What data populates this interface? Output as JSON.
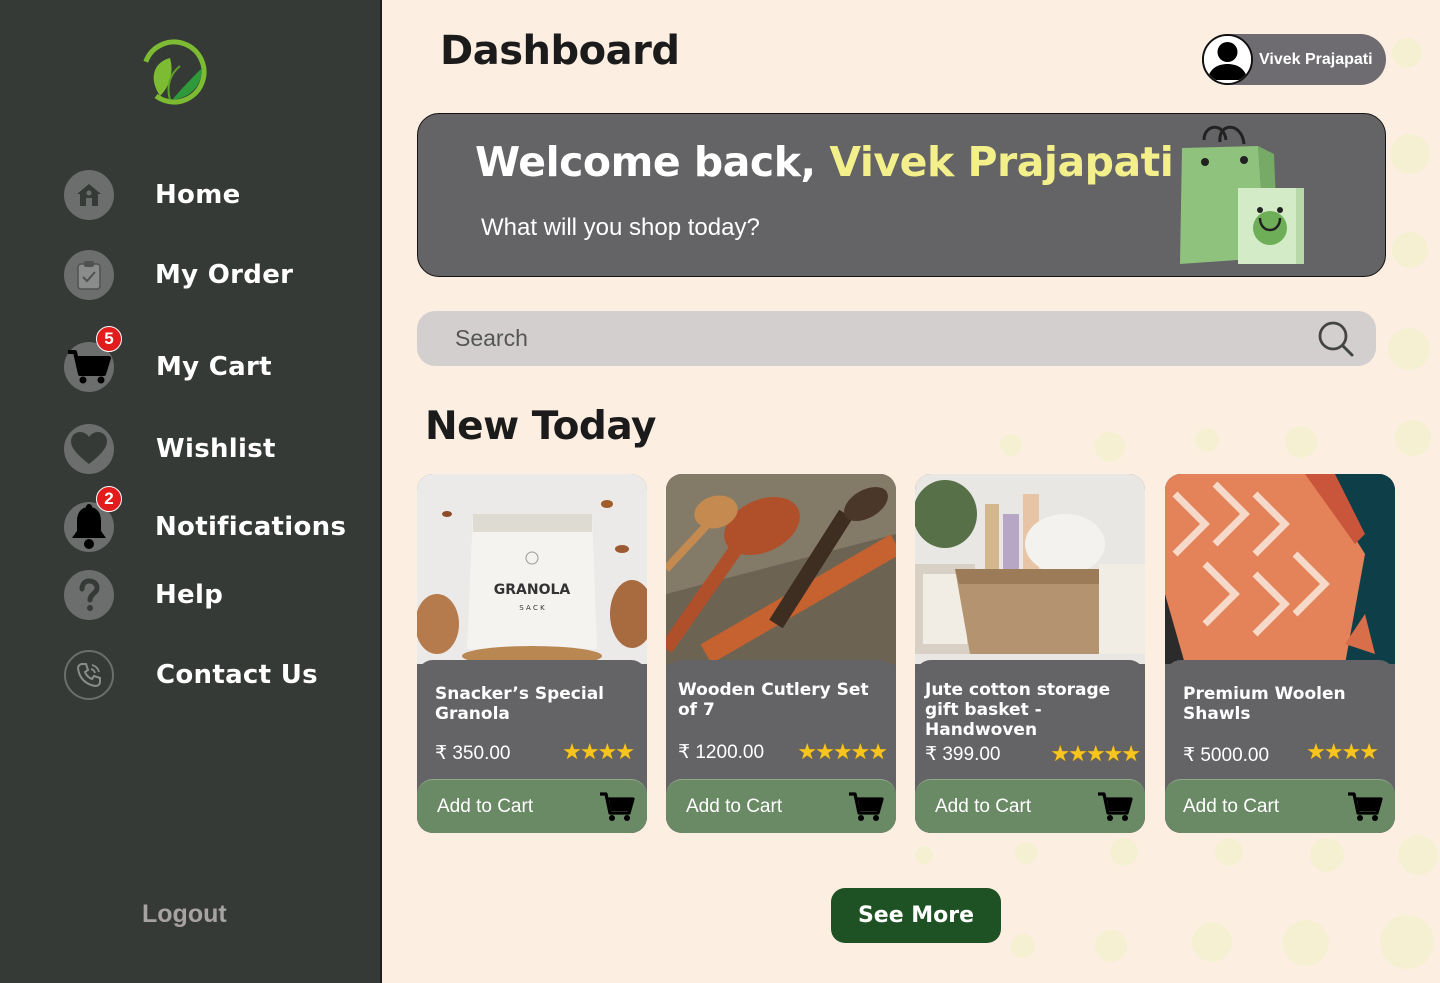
{
  "app": {
    "brand_colors": {
      "sidebar": "#363a37",
      "accent": "#1e5225",
      "card_button": "#6a8965",
      "highlight": "#f3f08b",
      "badge": "#e21c1c"
    }
  },
  "sidebar": {
    "logo_icon": "leaf-logo",
    "items": [
      {
        "label": "Home",
        "icon": "home-icon"
      },
      {
        "label": "My Order",
        "icon": "clipboard-check-icon"
      },
      {
        "label": "My Cart",
        "icon": "cart-icon",
        "badge": "5"
      },
      {
        "label": "Wishlist",
        "icon": "heart-icon"
      },
      {
        "label": "Notifications",
        "icon": "bell-icon",
        "badge": "2"
      },
      {
        "label": "Help",
        "icon": "question-icon"
      },
      {
        "label": "Contact Us",
        "icon": "phone-icon"
      }
    ],
    "logout_label": "Logout"
  },
  "header": {
    "title": "Dashboard",
    "user_name": "Vivek Prajapati"
  },
  "banner": {
    "welcome_prefix": "Welcome back, ",
    "welcome_name": "Vivek Prajapati",
    "subtitle": "What will you shop today?"
  },
  "search": {
    "placeholder": "Search"
  },
  "section": {
    "title": "New Today"
  },
  "products": [
    {
      "name": "Snacker’s Special Granola",
      "price": "₹ 350.00",
      "stars": "★★★★",
      "rating": 4,
      "button": "Add to Cart"
    },
    {
      "name": "Wooden Cutlery Set of 7",
      "price": "₹ 1200.00",
      "stars": "★★★★★",
      "rating": 5,
      "button": "Add to Cart"
    },
    {
      "name": "Jute cotton storage gift basket - Handwoven",
      "price": "₹ 399.00",
      "stars": "★★★★★",
      "rating": 5,
      "button": "Add to Cart"
    },
    {
      "name": "Premium Woolen Shawls",
      "price": "₹ 5000.00",
      "stars": "★★★★",
      "rating": 4,
      "button": "Add to Cart"
    }
  ],
  "see_more_label": "See More"
}
